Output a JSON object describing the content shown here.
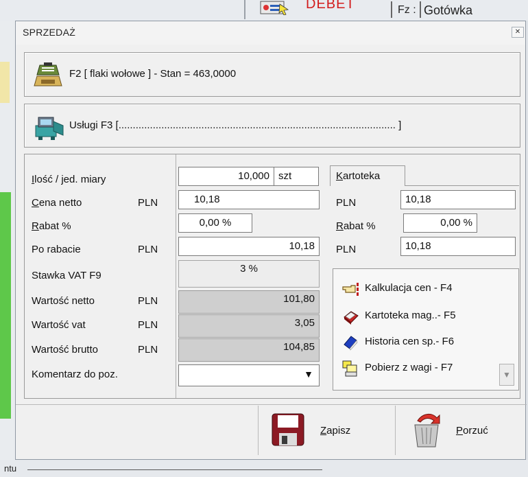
{
  "background": {
    "debet_label": "DEBET",
    "fz_label": "Fz :",
    "payment_method": "Gotówka",
    "bottom_fragment": "ntu"
  },
  "dialog": {
    "title": "SPRZEDAŻ",
    "close_symbol": "✕",
    "product_bar": {
      "text": "F2 [ flaki wołowe ] - Stan = 463,0000",
      "icon": "cash-drawer-icon"
    },
    "services_bar": {
      "text": "Usługi  F3 [................................................................................................. ]",
      "icon": "services-icon"
    },
    "fields": {
      "qty_label_first": "I",
      "qty_label_rest": "lość / jed. miary",
      "qty_value": "10,000",
      "unit_value": "szt",
      "net_label_first": "C",
      "net_label_rest": "ena netto",
      "net_currency": "PLN",
      "net_value": "10,18",
      "discount_label_first": "R",
      "discount_label_rest": "abat %",
      "discount_value": "0,00 %",
      "after_discount_label": "Po rabacie",
      "after_discount_currency": "PLN",
      "after_discount_value": "10,18",
      "vat_rate_label": "Stawka VAT F9",
      "vat_rate_value": "3 %",
      "net_total_label": "Wartość netto",
      "net_total_currency": "PLN",
      "net_total_value": "101,80",
      "vat_total_label": "Wartość vat",
      "vat_total_currency": "PLN",
      "vat_total_value": "3,05",
      "gross_total_label": "Wartość brutto",
      "gross_total_currency": "PLN",
      "gross_total_value": "104,85",
      "comment_label": "Komentarz do poz.",
      "comment_value": "",
      "comment_arrow": "▼"
    },
    "kartoteka": {
      "tab_first": "K",
      "tab_rest": "artoteka",
      "price_currency": "PLN",
      "price_value": "10,18",
      "discount_label_first": "R",
      "discount_label_rest": "abat %",
      "discount_value": "0,00 %",
      "after_currency": "PLN",
      "after_value": "10,18"
    },
    "actions": [
      {
        "label": "Kalkulacja cen  - F4",
        "icon": "pointing-hand-icon"
      },
      {
        "label": "Kartoteka mag..- F5",
        "icon": "red-box-icon"
      },
      {
        "label": "Historia cen sp.- F6",
        "icon": "blue-diamond-icon"
      },
      {
        "label": "Pobierz z wagi  - F7",
        "icon": "scale-icon"
      }
    ],
    "scroll_arrow": "▼",
    "buttons": {
      "save_first": "Z",
      "save_rest": "apisz",
      "cancel_first": "P",
      "cancel_rest": "orzuć"
    }
  }
}
